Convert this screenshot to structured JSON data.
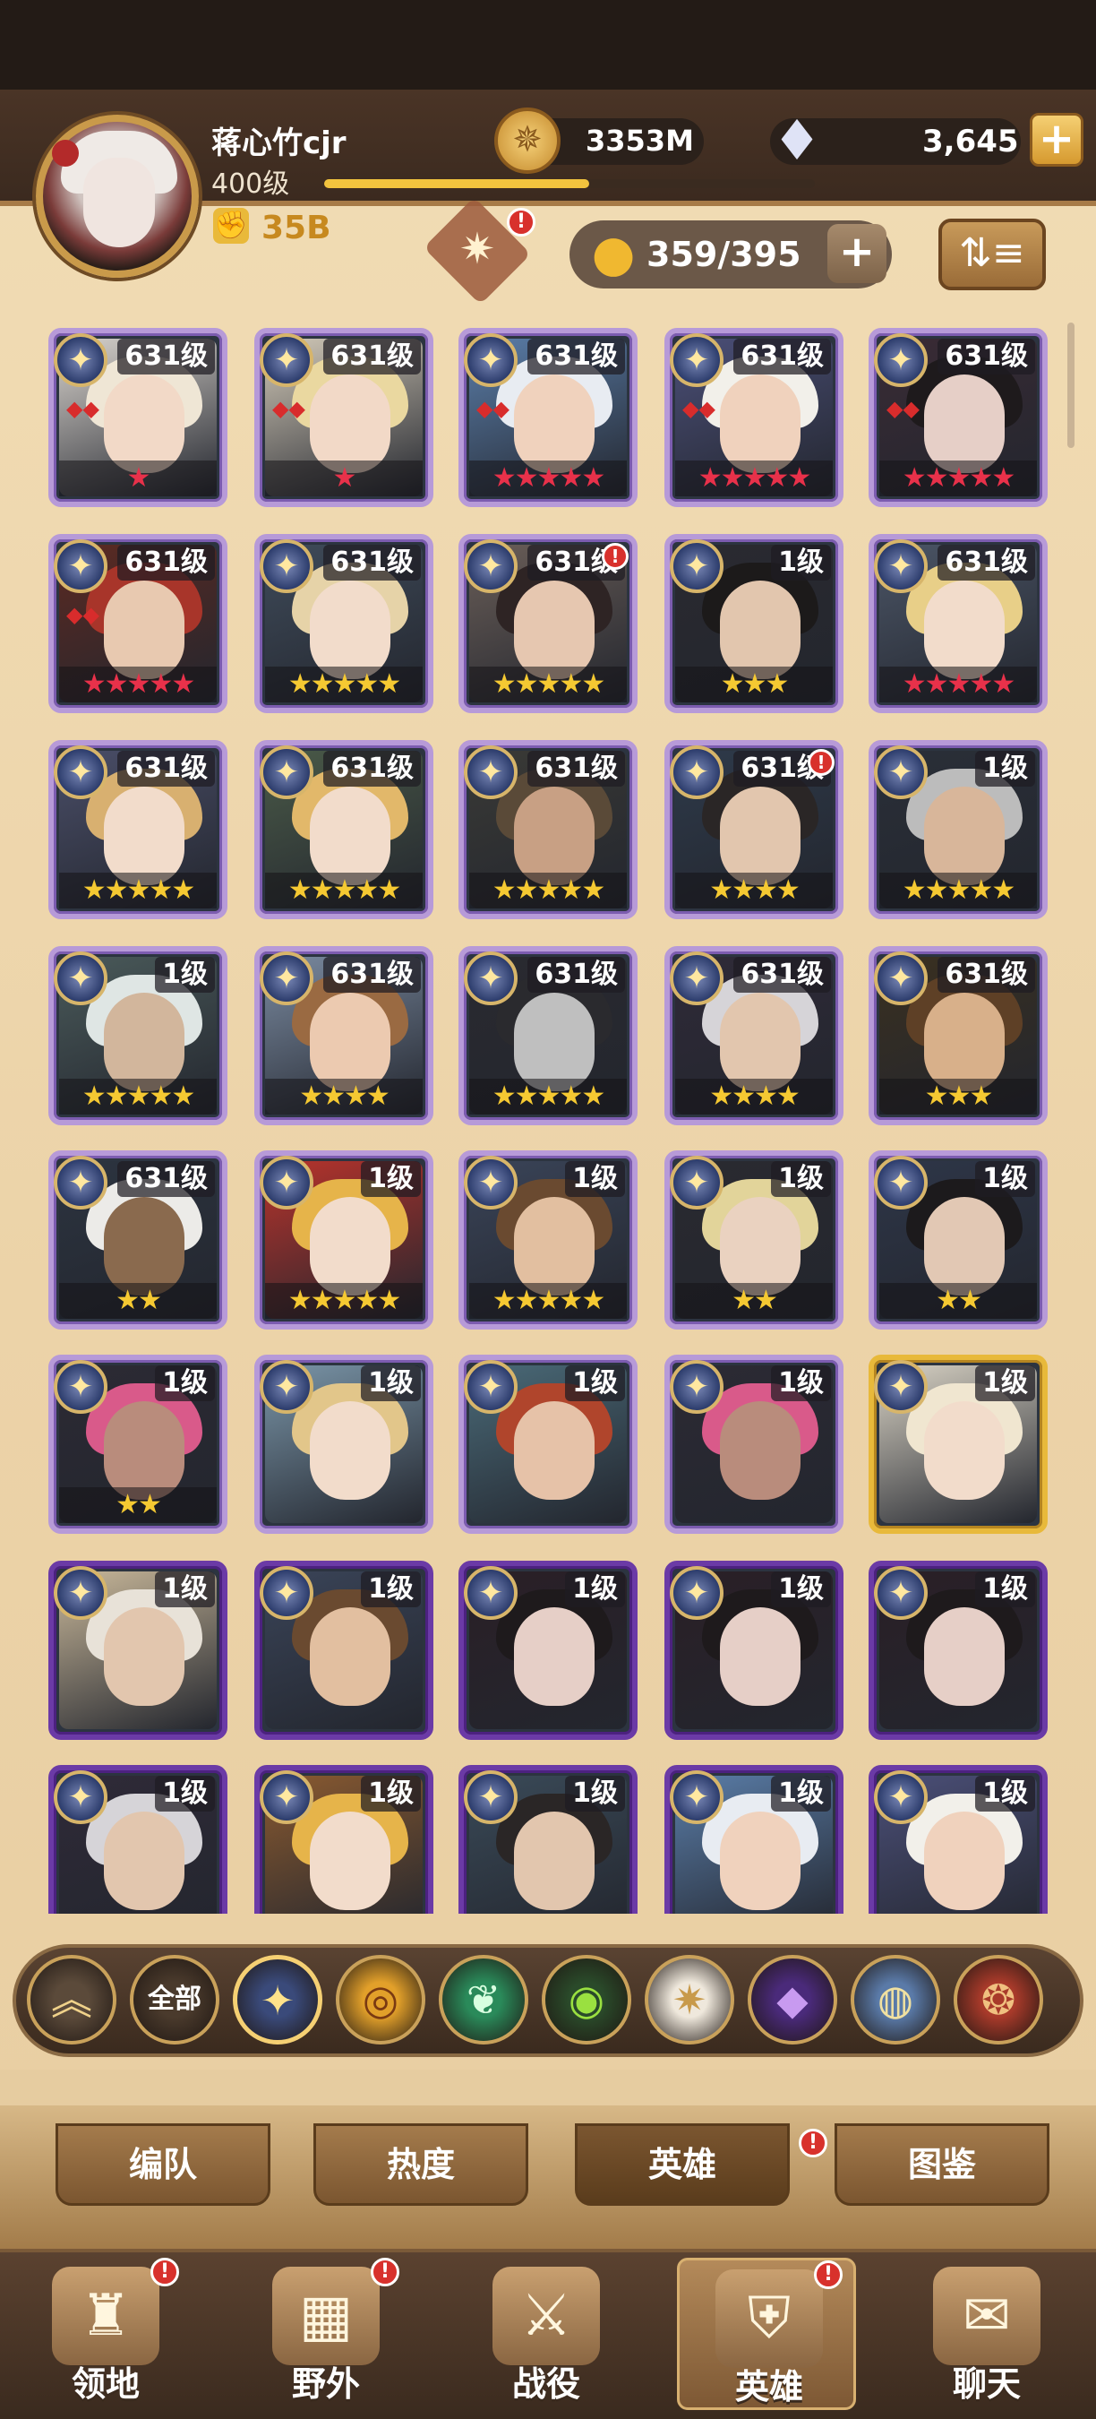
{
  "header": {
    "player_name": "蒋心竹cjr",
    "player_level": "400级",
    "xp_progress": 0.54,
    "power_icon": "fist-icon",
    "power_value": "35B",
    "gold_icon": "gold-coin-icon",
    "gold_value": "3353M",
    "gem_icon": "diamond-icon",
    "gem_value": "3,645",
    "gem_plus": "+",
    "hero_count": "359/395",
    "count_plus": "+",
    "sort_label": "⇅≡",
    "notification_mark": "!"
  },
  "heroes": [
    {
      "level": "631级",
      "stars": "★",
      "star_color": "red",
      "frame": "light",
      "wing": true,
      "gem": true,
      "hair": "#efe6d5",
      "skin": "#f2d9c7",
      "bg": "#d8d3cd"
    },
    {
      "level": "631级",
      "stars": "★",
      "star_color": "red",
      "frame": "light",
      "wing": true,
      "gem": true,
      "hair": "#ead8a0",
      "skin": "#f2d9c7",
      "bg": "#d2c9b8"
    },
    {
      "level": "631级",
      "stars": "★★★★★",
      "star_color": "red",
      "frame": "light",
      "wing": true,
      "gem": true,
      "hair": "#e8ecf2",
      "skin": "#f0d2bd",
      "bg": "#5a7da8"
    },
    {
      "level": "631级",
      "stars": "★★★★★",
      "star_color": "red",
      "frame": "light",
      "wing": true,
      "gem": true,
      "hair": "#f2f0ea",
      "skin": "#f0d2bd",
      "bg": "#4b4f78"
    },
    {
      "level": "631级",
      "stars": "★★★★★",
      "star_color": "red",
      "frame": "light",
      "wing": true,
      "gem": true,
      "hair": "#1e1a1c",
      "skin": "#e6cfc7",
      "bg": "#3a2b35"
    },
    {
      "level": "631级",
      "stars": "★★★★★",
      "star_color": "red",
      "frame": "light",
      "wing": true,
      "gem": true,
      "hair": "#a8352a",
      "skin": "#e8c9b0",
      "bg": "#5c2a22"
    },
    {
      "level": "631级",
      "stars": "★★★★★",
      "star_color": "yel",
      "frame": "light",
      "wing": true,
      "gem": false,
      "hair": "#e6d3a8",
      "skin": "#f2dccb",
      "bg": "#3f4b5a"
    },
    {
      "level": "631级",
      "stars": "★★★★★",
      "star_color": "yel",
      "frame": "light",
      "wing": true,
      "gem": false,
      "hair": "#2e2424",
      "skin": "#e6c7b0",
      "bg": "#6a5e58",
      "dot": true
    },
    {
      "level": "1级",
      "stars": "★★★",
      "star_color": "yel",
      "frame": "light",
      "wing": false,
      "gem": false,
      "hair": "#1c1a1a",
      "skin": "#e2c6ae",
      "bg": "#2a2a30"
    },
    {
      "level": "631级",
      "stars": "★★★★★",
      "star_color": "red",
      "frame": "light",
      "wing": true,
      "gem": false,
      "hair": "#e8cf88",
      "skin": "#f2dccb",
      "bg": "#4b5566"
    },
    {
      "level": "631级",
      "stars": "★★★★★",
      "star_color": "yel",
      "frame": "light",
      "wing": true,
      "gem": false,
      "hair": "#d8b070",
      "skin": "#f2dccb",
      "bg": "#4a4e68"
    },
    {
      "level": "631级",
      "stars": "★★★★★",
      "star_color": "yel",
      "frame": "light",
      "wing": true,
      "gem": false,
      "hair": "#e2b86a",
      "skin": "#f2dccb",
      "bg": "#4a5a48"
    },
    {
      "level": "631级",
      "stars": "★★★★★",
      "star_color": "yel",
      "frame": "light",
      "wing": false,
      "gem": false,
      "hair": "#5a4a38",
      "skin": "#c8a084",
      "bg": "#3a3a36"
    },
    {
      "level": "631级",
      "stars": "★★★★",
      "star_color": "yel",
      "frame": "light",
      "wing": false,
      "gem": false,
      "hair": "#2a2626",
      "skin": "#e2c6ae",
      "bg": "#2e3a4a",
      "dot": true
    },
    {
      "level": "1级",
      "stars": "★★★★★",
      "star_color": "yel",
      "frame": "light",
      "wing": false,
      "gem": false,
      "hair": "#bcbcbc",
      "skin": "#d8b69a",
      "bg": "#2a2f38"
    },
    {
      "level": "1级",
      "stars": "★★★★★",
      "star_color": "yel",
      "frame": "light",
      "wing": false,
      "gem": false,
      "hair": "#dfe6e4",
      "skin": "#d2b69c",
      "bg": "#4a5a5a"
    },
    {
      "level": "631级",
      "stars": "★★★★",
      "star_color": "yel",
      "frame": "light",
      "wing": false,
      "gem": false,
      "hair": "#9a6a42",
      "skin": "#eccab0",
      "bg": "#7a8aa0"
    },
    {
      "level": "631级",
      "stars": "★★★★★",
      "star_color": "yel",
      "frame": "light",
      "wing": false,
      "gem": false,
      "hair": "#2a2a2e",
      "skin": "#bfbfbf",
      "bg": "#2a2a30"
    },
    {
      "level": "631级",
      "stars": "★★★★",
      "star_color": "yel",
      "frame": "light",
      "wing": false,
      "gem": false,
      "hair": "#d6d4d8",
      "skin": "#e2c6ae",
      "bg": "#2f2a38"
    },
    {
      "level": "631级",
      "stars": "★★★",
      "star_color": "yel",
      "frame": "light",
      "wing": false,
      "gem": false,
      "hair": "#5e4026",
      "skin": "#d8b08a",
      "bg": "#3a3020"
    },
    {
      "level": "631级",
      "stars": "★★",
      "star_color": "yel",
      "frame": "light",
      "wing": false,
      "gem": false,
      "hair": "#ecebe8",
      "skin": "#8a6a4e",
      "bg": "#2c3440"
    },
    {
      "level": "1级",
      "stars": "★★★★★",
      "star_color": "yel",
      "frame": "light",
      "wing": false,
      "gem": false,
      "hair": "#e6b44a",
      "skin": "#f2dccb",
      "bg": "#b8332c"
    },
    {
      "level": "1级",
      "stars": "★★★★★",
      "star_color": "yel",
      "frame": "light",
      "wing": false,
      "gem": false,
      "hair": "#6a4a30",
      "skin": "#e2bfa0",
      "bg": "#3a4458"
    },
    {
      "level": "1级",
      "stars": "★★",
      "star_color": "yel",
      "frame": "light",
      "wing": false,
      "gem": false,
      "hair": "#e2d49a",
      "skin": "#ead2c0",
      "bg": "#2a2a30"
    },
    {
      "level": "1级",
      "stars": "★★",
      "star_color": "yel",
      "frame": "light",
      "wing": false,
      "gem": false,
      "hair": "#1c1a1c",
      "skin": "#e2c8b4",
      "bg": "#2e3648"
    },
    {
      "level": "1级",
      "stars": "★★",
      "star_color": "yel",
      "frame": "light",
      "wing": false,
      "gem": false,
      "hair": "#d95a8a",
      "skin": "#b98c7c",
      "bg": "#2c2a34"
    },
    {
      "level": "1级",
      "stars": "",
      "star_color": "yel",
      "frame": "purple-light",
      "wing": false,
      "gem": false,
      "hair": "#e2c68a",
      "skin": "#f2dccb",
      "bg": "#7a95a8"
    },
    {
      "level": "1级",
      "stars": "",
      "star_color": "yel",
      "frame": "purple-light",
      "wing": false,
      "gem": false,
      "hair": "#b0452c",
      "skin": "#e6c2a8",
      "bg": "#4a6a78"
    },
    {
      "level": "1级",
      "stars": "",
      "star_color": "yel",
      "frame": "purple-light",
      "wing": false,
      "gem": false,
      "hair": "#d95a8a",
      "skin": "#b98c7c",
      "bg": "#2c2a34"
    },
    {
      "level": "1级",
      "stars": "",
      "star_color": "yel",
      "frame": "gold",
      "wing": false,
      "gem": false,
      "hair": "#f0e6d0",
      "skin": "#f2dccb",
      "bg": "#d8d2c4"
    },
    {
      "level": "1级",
      "stars": "",
      "star_color": "yel",
      "frame": "purple",
      "wing": false,
      "gem": false,
      "hair": "#e8e2d8",
      "skin": "#e2c6ae",
      "bg": "#c9b89a"
    },
    {
      "level": "1级",
      "stars": "",
      "star_color": "yel",
      "frame": "purple",
      "wing": false,
      "gem": false,
      "hair": "#6a4a30",
      "skin": "#e2bfa0",
      "bg": "#3a4458"
    },
    {
      "level": "1级",
      "stars": "",
      "star_color": "yel",
      "frame": "purple",
      "wing": false,
      "gem": false,
      "hair": "#1e1a1c",
      "skin": "#e6cfc7",
      "bg": "#2a1f26"
    },
    {
      "level": "1级",
      "stars": "",
      "star_color": "yel",
      "frame": "purple",
      "wing": false,
      "gem": false,
      "hair": "#1e1a1c",
      "skin": "#e6cfc7",
      "bg": "#2a1f26"
    },
    {
      "level": "1级",
      "stars": "",
      "star_color": "yel",
      "frame": "purple",
      "wing": false,
      "gem": false,
      "hair": "#1e1a1c",
      "skin": "#e6cfc7",
      "bg": "#2a1f26"
    },
    {
      "level": "1级",
      "stars": "",
      "star_color": "yel",
      "frame": "purple",
      "wing": false,
      "gem": false,
      "hair": "#d6d4d8",
      "skin": "#e2c6ae",
      "bg": "#2f2a38"
    },
    {
      "level": "1级",
      "stars": "",
      "star_color": "yel",
      "frame": "purple",
      "wing": false,
      "gem": false,
      "hair": "#e6b44a",
      "skin": "#f2dccb",
      "bg": "#8a5a30"
    },
    {
      "level": "1级",
      "stars": "",
      "star_color": "yel",
      "frame": "purple",
      "wing": false,
      "gem": false,
      "hair": "#2a2626",
      "skin": "#e2c6ae",
      "bg": "#3a4a58"
    },
    {
      "level": "1级",
      "stars": "",
      "star_color": "yel",
      "frame": "purple",
      "wing": false,
      "gem": false,
      "hair": "#e8ecf2",
      "skin": "#f0d2bd",
      "bg": "#5a7da8"
    },
    {
      "level": "1级",
      "stars": "",
      "star_color": "yel",
      "frame": "purple",
      "wing": false,
      "gem": false,
      "hair": "#f2f0ea",
      "skin": "#f0d2bd",
      "bg": "#4b4f78"
    }
  ],
  "filters": [
    {
      "name": "collapse",
      "glyph": "︽",
      "bg": "#5b4a3a",
      "fg": "#f0d28a"
    },
    {
      "name": "all",
      "glyph": "全部",
      "bg": "#4a3a2c",
      "fg": "#ffffff"
    },
    {
      "name": "lightbearer",
      "glyph": "✦",
      "bg": "#3a4a7a",
      "fg": "#ffe28a"
    },
    {
      "name": "mauler",
      "glyph": "◎",
      "bg": "#e2a02a",
      "fg": "#7a3a12"
    },
    {
      "name": "wilder",
      "glyph": "❦",
      "bg": "#2a8a5a",
      "fg": "#d8ffe0"
    },
    {
      "name": "graveborn",
      "glyph": "◉",
      "bg": "#2a4a2a",
      "fg": "#9ae040"
    },
    {
      "name": "celestial",
      "glyph": "✷",
      "bg": "#efe8dc",
      "fg": "#c89a4a"
    },
    {
      "name": "hypogean",
      "glyph": "◆",
      "bg": "#4a2a7a",
      "fg": "#c89af0"
    },
    {
      "name": "dimensional",
      "glyph": "◍",
      "bg": "#5a7aa8",
      "fg": "#f0e0a0"
    },
    {
      "name": "draconis",
      "glyph": "❂",
      "bg": "#a83a2a",
      "fg": "#f0c080"
    }
  ],
  "tabs": [
    {
      "label": "编队",
      "active": false
    },
    {
      "label": "热度",
      "active": false
    },
    {
      "label": "英雄",
      "active": true,
      "dot": true
    },
    {
      "label": "图鉴",
      "active": false
    }
  ],
  "nav": [
    {
      "label": "领地",
      "icon": "castle-icon",
      "glyph": "♜",
      "dot": true,
      "active": false
    },
    {
      "label": "野外",
      "icon": "map-icon",
      "glyph": "▦",
      "dot": true,
      "active": false
    },
    {
      "label": "战役",
      "icon": "sword-icon",
      "glyph": "⚔",
      "dot": false,
      "active": false
    },
    {
      "label": "英雄",
      "icon": "helmet-icon",
      "glyph": "⛨",
      "dot": true,
      "active": true
    },
    {
      "label": "聊天",
      "icon": "chat-icon",
      "glyph": "✉",
      "dot": false,
      "active": false
    }
  ]
}
